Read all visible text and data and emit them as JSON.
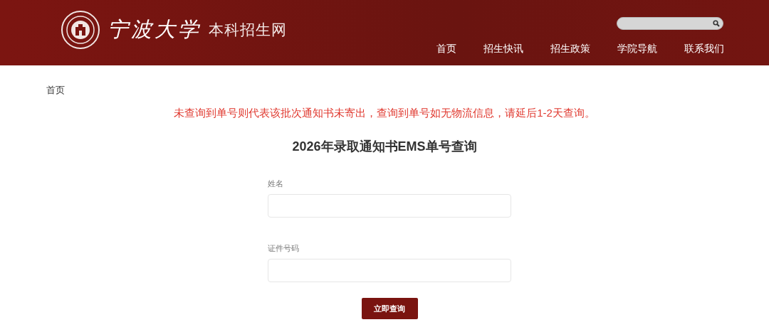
{
  "header": {
    "logo_name": "宁波大学",
    "site_name": "本科招生网",
    "nav": [
      "首页",
      "招生快讯",
      "招生政策",
      "学院导航",
      "联系我们"
    ]
  },
  "breadcrumb": "首页",
  "notice": "未查询到单号则代表该批次通知书未寄出，查询到单号如无物流信息，请延后1-2天查询。",
  "form": {
    "title": "2026年录取通知书EMS单号查询",
    "fields": [
      {
        "label": "姓名"
      },
      {
        "label": "证件号码"
      }
    ],
    "submit": "立即查询"
  }
}
